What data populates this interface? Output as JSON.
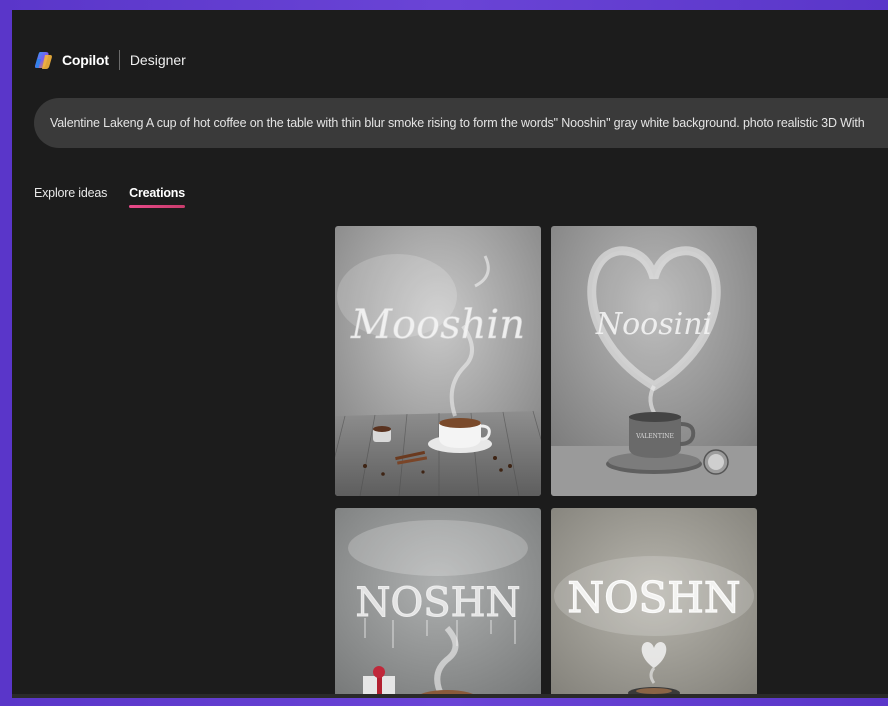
{
  "header": {
    "brand": "Copilot",
    "product": "Designer"
  },
  "prompt": {
    "text": "Valentine Lakeng A cup of hot coffee on the table with thin blur smoke rising to form the words\" Nooshin\" gray white background. photo realistic 3D With"
  },
  "tabs": [
    {
      "label": "Explore ideas",
      "active": false
    },
    {
      "label": "Creations",
      "active": true
    }
  ],
  "creations": [
    {
      "smoke_text": "Mooshin",
      "mug_text": ""
    },
    {
      "smoke_text": "Noosini",
      "mug_text": "VALENTINE"
    },
    {
      "smoke_text": "NOSHN",
      "mug_text": ""
    },
    {
      "smoke_text": "NOSHN",
      "mug_text": ""
    }
  ],
  "colors": {
    "frame": "#5a36c9",
    "background": "#1c1c1c",
    "prompt_bar": "#3a3a3a",
    "tab_underline": "#e84a8a"
  }
}
